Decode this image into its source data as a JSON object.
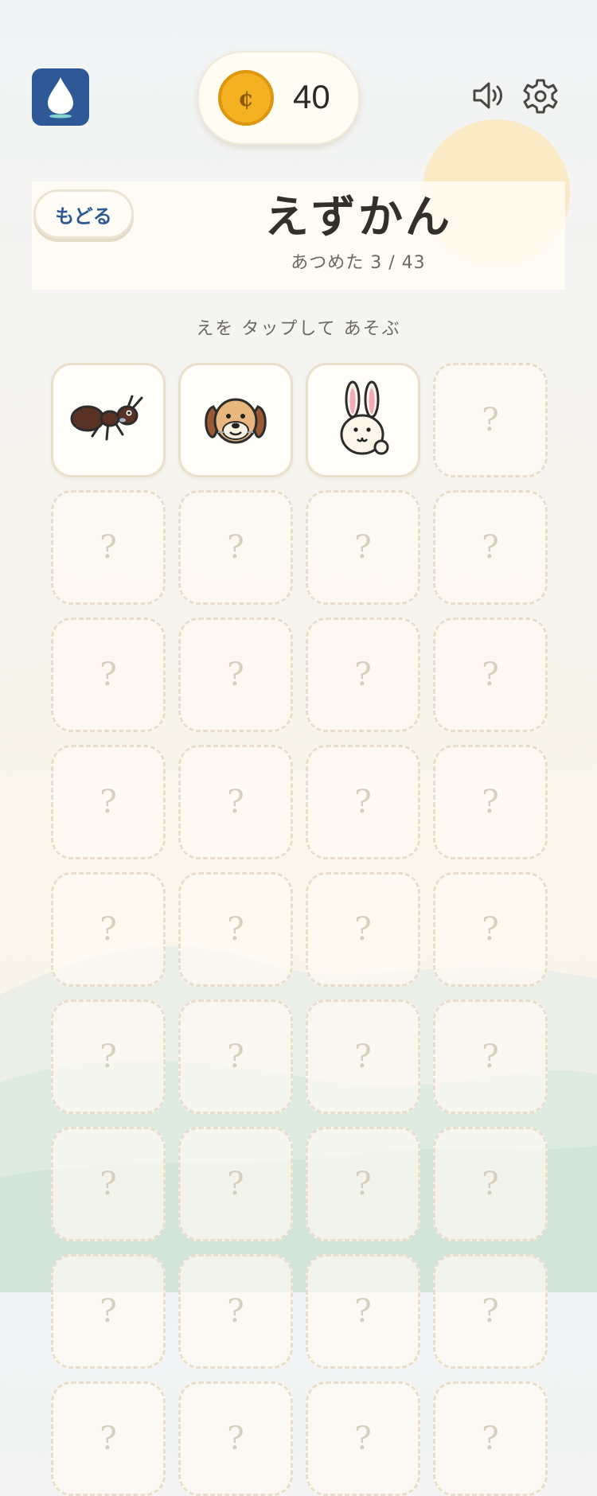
{
  "header": {
    "coins": "40",
    "back_label": "もどる",
    "title": "えずかん",
    "collected_text": "あつめた 3 / 43",
    "hint": "えを タップして あそぶ"
  },
  "icons": {
    "app": "water-drop-icon",
    "coin": "coin-icon",
    "coin_symbol": "¢",
    "sound": "speaker-icon",
    "settings": "gear-icon"
  },
  "colors": {
    "accent": "#2f5896",
    "coin": "#f3b121",
    "card_border": "#ebdfcb"
  },
  "collection": {
    "found": [
      {
        "name": "ant",
        "icon": "ant-icon"
      },
      {
        "name": "dog",
        "icon": "dog-icon"
      },
      {
        "name": "rabbit",
        "icon": "rabbit-icon"
      }
    ],
    "locked_placeholder": "?"
  }
}
